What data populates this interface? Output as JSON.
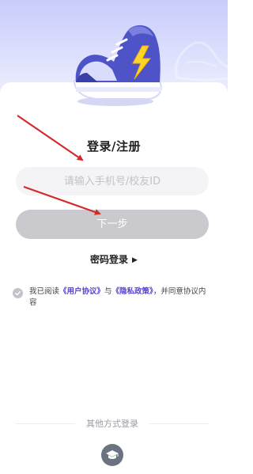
{
  "header": {
    "title": "登录/注册"
  },
  "login_form": {
    "phone_placeholder": "请输入手机号/校友ID",
    "phone_value": "",
    "next_label": "下一步",
    "password_login_label": "密码登录"
  },
  "agreement": {
    "checked": false,
    "prefix": "我已阅读",
    "user_agreement": "《用户协议》",
    "and": "与",
    "privacy_policy": "《隐私政策》",
    "suffix": "，并同意协议内容"
  },
  "other_login": {
    "label": "其他方式登录",
    "icons": [
      "graduation-cap-icon"
    ]
  },
  "colors": {
    "accent_link": "#5b3fd1",
    "button_disabled": "#c9c9ce",
    "annotation_arrow": "#d42a2a"
  }
}
